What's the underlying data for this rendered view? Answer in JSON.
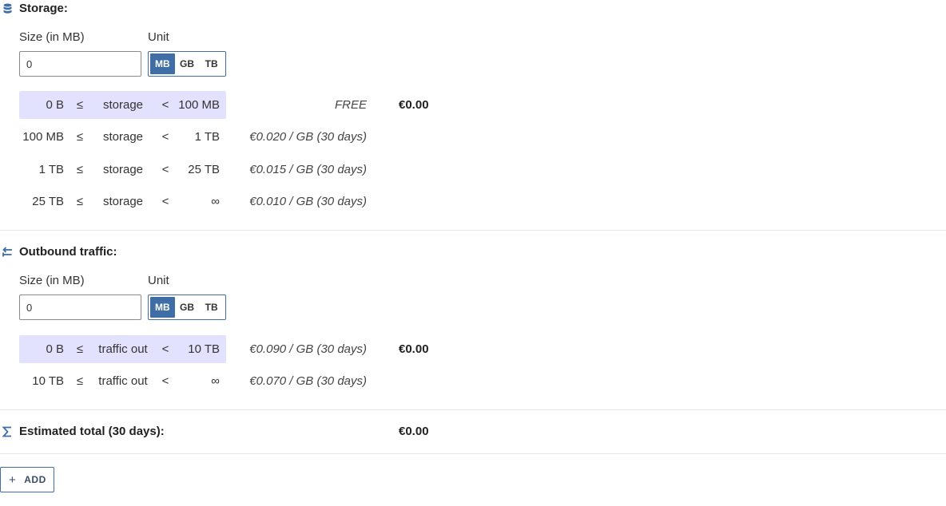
{
  "storage": {
    "title": "Storage:",
    "icon": "database-icon",
    "size_label": "Size (in MB)",
    "unit_label": "Unit",
    "size_value": "0",
    "units": [
      "MB",
      "GB",
      "TB"
    ],
    "active_unit": "MB",
    "tiers": [
      {
        "from": "0 B",
        "le": "≤",
        "var": "storage",
        "lt": "<",
        "to": "100 MB",
        "price": "FREE",
        "cost": "€0.00",
        "highlight": true
      },
      {
        "from": "100 MB",
        "le": "≤",
        "var": "storage",
        "lt": "<",
        "to": "1 TB",
        "price": "€0.020 / GB (30 days)",
        "cost": "",
        "highlight": false
      },
      {
        "from": "1 TB",
        "le": "≤",
        "var": "storage",
        "lt": "<",
        "to": "25 TB",
        "price": "€0.015 / GB (30 days)",
        "cost": "",
        "highlight": false
      },
      {
        "from": "25 TB",
        "le": "≤",
        "var": "storage",
        "lt": "<",
        "to": "∞",
        "price": "€0.010 / GB (30 days)",
        "cost": "",
        "highlight": false
      }
    ]
  },
  "traffic": {
    "title": "Outbound traffic:",
    "icon": "transfer-arrows-icon",
    "size_label": "Size (in MB)",
    "unit_label": "Unit",
    "size_value": "0",
    "units": [
      "MB",
      "GB",
      "TB"
    ],
    "active_unit": "MB",
    "tiers": [
      {
        "from": "0 B",
        "le": "≤",
        "var": "traffic out",
        "lt": "<",
        "to": "10 TB",
        "price": "€0.090 / GB (30 days)",
        "cost": "€0.00",
        "highlight": true
      },
      {
        "from": "10 TB",
        "le": "≤",
        "var": "traffic out",
        "lt": "<",
        "to": "∞",
        "price": "€0.070 / GB (30 days)",
        "cost": "",
        "highlight": false
      }
    ]
  },
  "total": {
    "label": "Estimated total (30 days):",
    "icon": "sigma-icon",
    "value": "€0.00"
  },
  "add_button": {
    "label": "ADD",
    "icon": "plus-icon"
  },
  "colors": {
    "accent": "#3f6ea6",
    "highlight_row": "#e2e2ff"
  }
}
